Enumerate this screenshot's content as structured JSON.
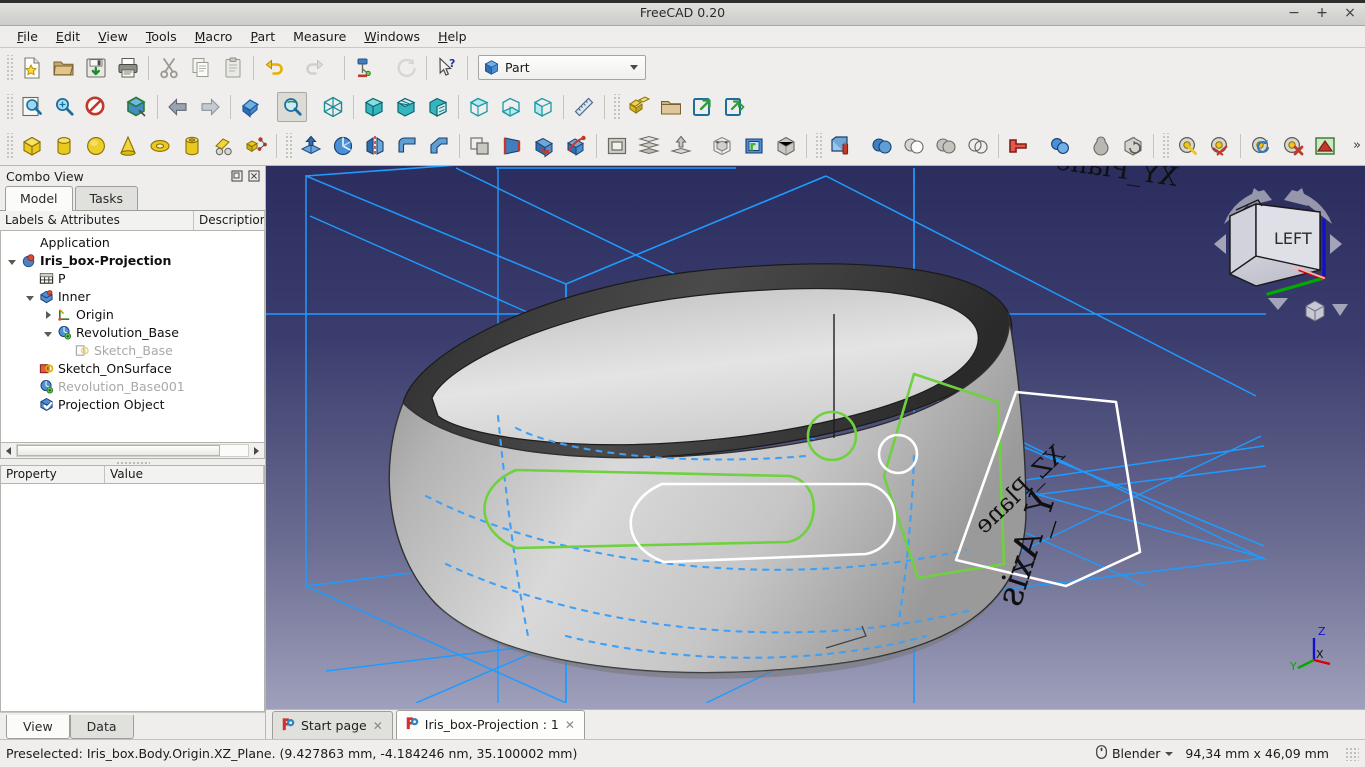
{
  "window": {
    "title": "FreeCAD 0.20",
    "minimize": "−",
    "maximize": "+",
    "close": "×"
  },
  "menubar": [
    {
      "label": "File",
      "accel": "F"
    },
    {
      "label": "Edit",
      "accel": "E"
    },
    {
      "label": "View",
      "accel": "V"
    },
    {
      "label": "Tools",
      "accel": "T"
    },
    {
      "label": "Macro",
      "accel": "M"
    },
    {
      "label": "Part",
      "accel": "P"
    },
    {
      "label": "Measure",
      "accel": ""
    },
    {
      "label": "Windows",
      "accel": "W"
    },
    {
      "label": "Help",
      "accel": "H"
    }
  ],
  "toolbars": {
    "file_row": [
      {
        "name": "new-document-button",
        "title": "New"
      },
      {
        "name": "open-document-button",
        "title": "Open"
      },
      {
        "name": "save-document-button",
        "title": "Save"
      },
      {
        "name": "print-document-button",
        "title": "Print"
      },
      {
        "name": "cut-button",
        "title": "Cut"
      },
      {
        "name": "copy-button",
        "title": "Copy"
      },
      {
        "name": "paste-button",
        "title": "Paste"
      },
      {
        "name": "undo-button",
        "title": "Undo"
      },
      {
        "name": "redo-button",
        "title": "Redo"
      },
      {
        "name": "refresh-button",
        "title": "Refresh"
      },
      {
        "name": "whats-this-button",
        "title": "What's This"
      }
    ],
    "workbench_label": "Part",
    "view_row": [
      {
        "name": "fit-all-button",
        "title": "Fit all"
      },
      {
        "name": "fit-selection-button",
        "title": "Fit selection"
      },
      {
        "name": "draw-style-button",
        "title": "Draw style"
      },
      {
        "name": "axonometric-view-button",
        "title": "Axonometric"
      },
      {
        "name": "view-back-button",
        "title": "Back"
      },
      {
        "name": "view-forward-button",
        "title": "Forward"
      },
      {
        "name": "freeze-view-button",
        "title": "Freeze display"
      },
      {
        "name": "zoom-box-button",
        "title": "Box zoom"
      },
      {
        "name": "isometric-view-button",
        "title": "Isometric"
      },
      {
        "name": "front-view-button",
        "title": "Front"
      },
      {
        "name": "top-view-button",
        "title": "Top"
      },
      {
        "name": "right-view-button",
        "title": "Right"
      },
      {
        "name": "rear-view-button",
        "title": "Rear"
      },
      {
        "name": "bottom-view-button",
        "title": "Bottom"
      },
      {
        "name": "left-view-button",
        "title": "Left"
      },
      {
        "name": "measure-distance-button",
        "title": "Measure"
      }
    ],
    "structure_row": [
      {
        "name": "create-part-button",
        "title": "Create part"
      },
      {
        "name": "create-group-button",
        "title": "Create group"
      },
      {
        "name": "make-link-button",
        "title": "Make link"
      },
      {
        "name": "make-sublink-button",
        "title": "Make sub-link"
      }
    ],
    "part_row": [
      {
        "name": "box-primitive-button",
        "title": "Box"
      },
      {
        "name": "cylinder-primitive-button",
        "title": "Cylinder"
      },
      {
        "name": "sphere-primitive-button",
        "title": "Sphere"
      },
      {
        "name": "cone-primitive-button",
        "title": "Cone"
      },
      {
        "name": "torus-primitive-button",
        "title": "Torus"
      },
      {
        "name": "tube-primitive-button",
        "title": "Tube"
      },
      {
        "name": "shape-builder-button",
        "title": "Shape builder"
      },
      {
        "name": "primitives-button",
        "title": "Primitives"
      },
      {
        "name": "extrude-button",
        "title": "Extrude"
      },
      {
        "name": "revolve-button",
        "title": "Revolve"
      },
      {
        "name": "mirror-button",
        "title": "Mirror"
      },
      {
        "name": "fillet-button",
        "title": "Fillet"
      },
      {
        "name": "chamfer-button",
        "title": "Chamfer"
      },
      {
        "name": "offset-2d-button",
        "title": "2D Offset"
      },
      {
        "name": "ruled-surface-button",
        "title": "Ruled surface"
      },
      {
        "name": "loft-button",
        "title": "Loft"
      },
      {
        "name": "sweep-button",
        "title": "Sweep"
      },
      {
        "name": "thickness-button",
        "title": "Thickness"
      },
      {
        "name": "sections-button",
        "title": "Sections"
      },
      {
        "name": "cross-sections-button",
        "title": "Cross-sections"
      },
      {
        "name": "projection-on-surface-button",
        "title": "Projection on surface"
      },
      {
        "name": "shape-info-button",
        "title": "Shape info"
      },
      {
        "name": "bounding-box-button",
        "title": "Bounding box"
      },
      {
        "name": "boolean-button",
        "title": "Boolean"
      },
      {
        "name": "union-button",
        "title": "Union"
      },
      {
        "name": "cut-shapes-button",
        "title": "Cut"
      },
      {
        "name": "common-shapes-button",
        "title": "Common"
      },
      {
        "name": "connect-objects-button",
        "title": "Connect objects"
      },
      {
        "name": "join-button",
        "title": "Join"
      },
      {
        "name": "split-button",
        "title": "Split"
      },
      {
        "name": "compound-tools-button",
        "title": "Compound tools"
      },
      {
        "name": "compound-filter-button",
        "title": "Compound filter"
      },
      {
        "name": "measure-linear-button",
        "title": "Measure linear"
      },
      {
        "name": "measure-angular-button",
        "title": "Measure angular"
      },
      {
        "name": "measure-refresh-button",
        "title": "Refresh measure"
      },
      {
        "name": "measure-clear-all-button",
        "title": "Clear all"
      },
      {
        "name": "measure-toggle-button",
        "title": "Toggle measurement"
      }
    ],
    "overflow_label": "»"
  },
  "combo_view": {
    "dock_title": "Combo View",
    "float_icon": "float-icon",
    "close_icon": "close-icon",
    "tabs": [
      {
        "label": "Model",
        "active": true
      },
      {
        "label": "Tasks",
        "active": false
      }
    ],
    "tree_columns": [
      "Labels & Attributes",
      "Description"
    ],
    "tree": [
      {
        "label": "Application",
        "depth": 0,
        "twisty": "none",
        "icon": "none",
        "bold": false,
        "dim": false
      },
      {
        "label": "Iris_box-Projection",
        "depth": 0,
        "twisty": "expanded",
        "icon": "document-icon",
        "bold": true,
        "dim": false
      },
      {
        "label": "P",
        "depth": 1,
        "twisty": "none",
        "icon": "spreadsheet-icon",
        "bold": false,
        "dim": false
      },
      {
        "label": "Inner",
        "depth": 1,
        "twisty": "expanded",
        "icon": "body-icon",
        "bold": false,
        "dim": false
      },
      {
        "label": "Origin",
        "depth": 2,
        "twisty": "collapsed",
        "icon": "origin-icon",
        "bold": false,
        "dim": false
      },
      {
        "label": "Revolution_Base",
        "depth": 2,
        "twisty": "expanded",
        "icon": "revolution-icon",
        "bold": false,
        "dim": false
      },
      {
        "label": "Sketch_Base",
        "depth": 3,
        "twisty": "none",
        "icon": "sketch-icon",
        "bold": false,
        "dim": true
      },
      {
        "label": "Sketch_OnSurface",
        "depth": 1,
        "twisty": "none",
        "icon": "sketch-red-icon",
        "bold": false,
        "dim": false
      },
      {
        "label": "Revolution_Base001",
        "depth": 1,
        "twisty": "none",
        "icon": "revolution-icon",
        "bold": false,
        "dim": true
      },
      {
        "label": "Projection Object",
        "depth": 1,
        "twisty": "none",
        "icon": "projection-icon",
        "bold": false,
        "dim": false
      }
    ],
    "property_columns": [
      "Property",
      "Value"
    ],
    "property_rows": [],
    "bottom_tabs": [
      {
        "label": "View",
        "active": true
      },
      {
        "label": "Data",
        "active": false
      }
    ]
  },
  "viewport": {
    "labels": [
      {
        "text": "XY_Plane",
        "name": "xy-plane-label"
      },
      {
        "text": "XZ_Plane",
        "name": "xz-plane-label"
      },
      {
        "text": "Y_Axis",
        "name": "y-axis-label"
      }
    ],
    "navcube": {
      "face": "LEFT"
    },
    "axis_cross": {
      "x": "X",
      "y": "Y",
      "z": "Z"
    },
    "colors": {
      "background_top": "#2b2d5e",
      "background_bottom": "#9fa0bb",
      "plane_line": "#1b9bff",
      "hidden_line": "#3fa0f5",
      "sketch_green": "#6fd13f",
      "sketch_white": "#ffffff",
      "solid_light": "#d6d6d6",
      "solid_dark": "#3a3a3a",
      "axis_x": "#ff0000",
      "axis_y": "#00bb00",
      "axis_z": "#0000dd"
    }
  },
  "document_tabs": [
    {
      "label": "Start page",
      "active": false,
      "close": "✕",
      "icon": "freecad-icon"
    },
    {
      "label": "Iris_box-Projection : 1",
      "active": true,
      "close": "✕",
      "icon": "freecad-icon"
    }
  ],
  "statusbar": {
    "message": "Preselected: Iris_box.Body.Origin.XZ_Plane. (9.427863 mm, -4.184246 nm, 35.100002 mm)",
    "navigation_mode": "Blender",
    "dimensions": "94,34 mm x 46,09 mm"
  }
}
